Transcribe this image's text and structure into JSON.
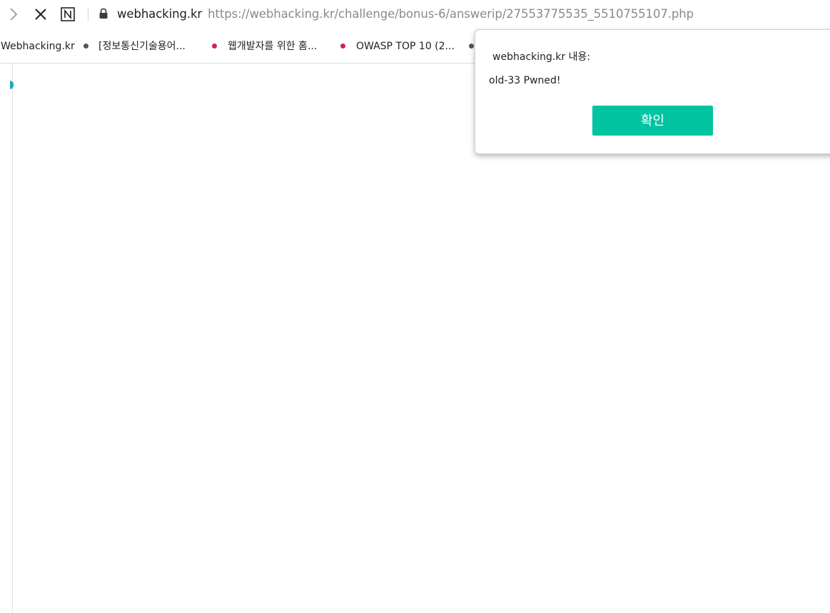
{
  "toolbar": {
    "host": "webhacking.kr",
    "url": "https://webhacking.kr/challenge/bonus-6/answerip/27553775535_5510755107.php"
  },
  "bookmarks": [
    {
      "label": "Webhacking.kr",
      "dot_color": ""
    },
    {
      "label": "[정보통신기술용어...",
      "dot_color": "#555555"
    },
    {
      "label": "웹개발자를 위한 홈...",
      "dot_color": "#d81b60"
    },
    {
      "label": "OWASP TOP 10 (2...",
      "dot_color": "#d81b60"
    },
    {
      "label": "",
      "dot_color": "#555555"
    }
  ],
  "dialog": {
    "title": "webhacking.kr 내용:",
    "message": "old-33 Pwned!",
    "ok_label": "확인"
  },
  "colors": {
    "accent_button": "#03c4a1",
    "url_host": "#202124",
    "url_path": "#8a8a8a"
  },
  "icons": {
    "forward": "chevron-right-icon",
    "stop": "close-icon",
    "naver": "naver-n-icon",
    "lock": "lock-icon"
  }
}
